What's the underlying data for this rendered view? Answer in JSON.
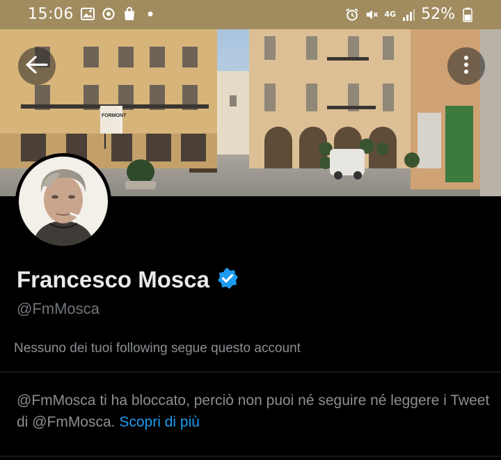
{
  "status_bar": {
    "time": "15:06",
    "battery_percent": "52%",
    "network_label": "4G",
    "icons_left": [
      "gallery-icon",
      "sync-icon",
      "shopping-bag-icon",
      "dot-icon"
    ],
    "icons_right": [
      "alarm-icon",
      "mute-icon",
      "network-icon",
      "signal-icon",
      "battery-icon"
    ]
  },
  "header": {
    "back_icon": "arrow-left-icon",
    "more_icon": "more-vertical-icon",
    "banner_shop_sign": "FORMONT"
  },
  "profile": {
    "display_name": "Francesco Mosca",
    "verified": true,
    "handle": "@FmMosca",
    "followers_you_know": "Nessuno dei tuoi following segue questo account"
  },
  "blocked_notice": {
    "text": "@FmMosca ti ha bloccato, perciò non puoi né seguire né leggere i Tweet di @FmMosca.",
    "link_label": "Scopri di più"
  },
  "colors": {
    "background": "#000000",
    "status_bar": "#a08c5f",
    "primary_text": "#e7e9ea",
    "secondary_text": "#71767b",
    "link": "#1d9bf0",
    "verified_badge": "#1d9bf0"
  }
}
